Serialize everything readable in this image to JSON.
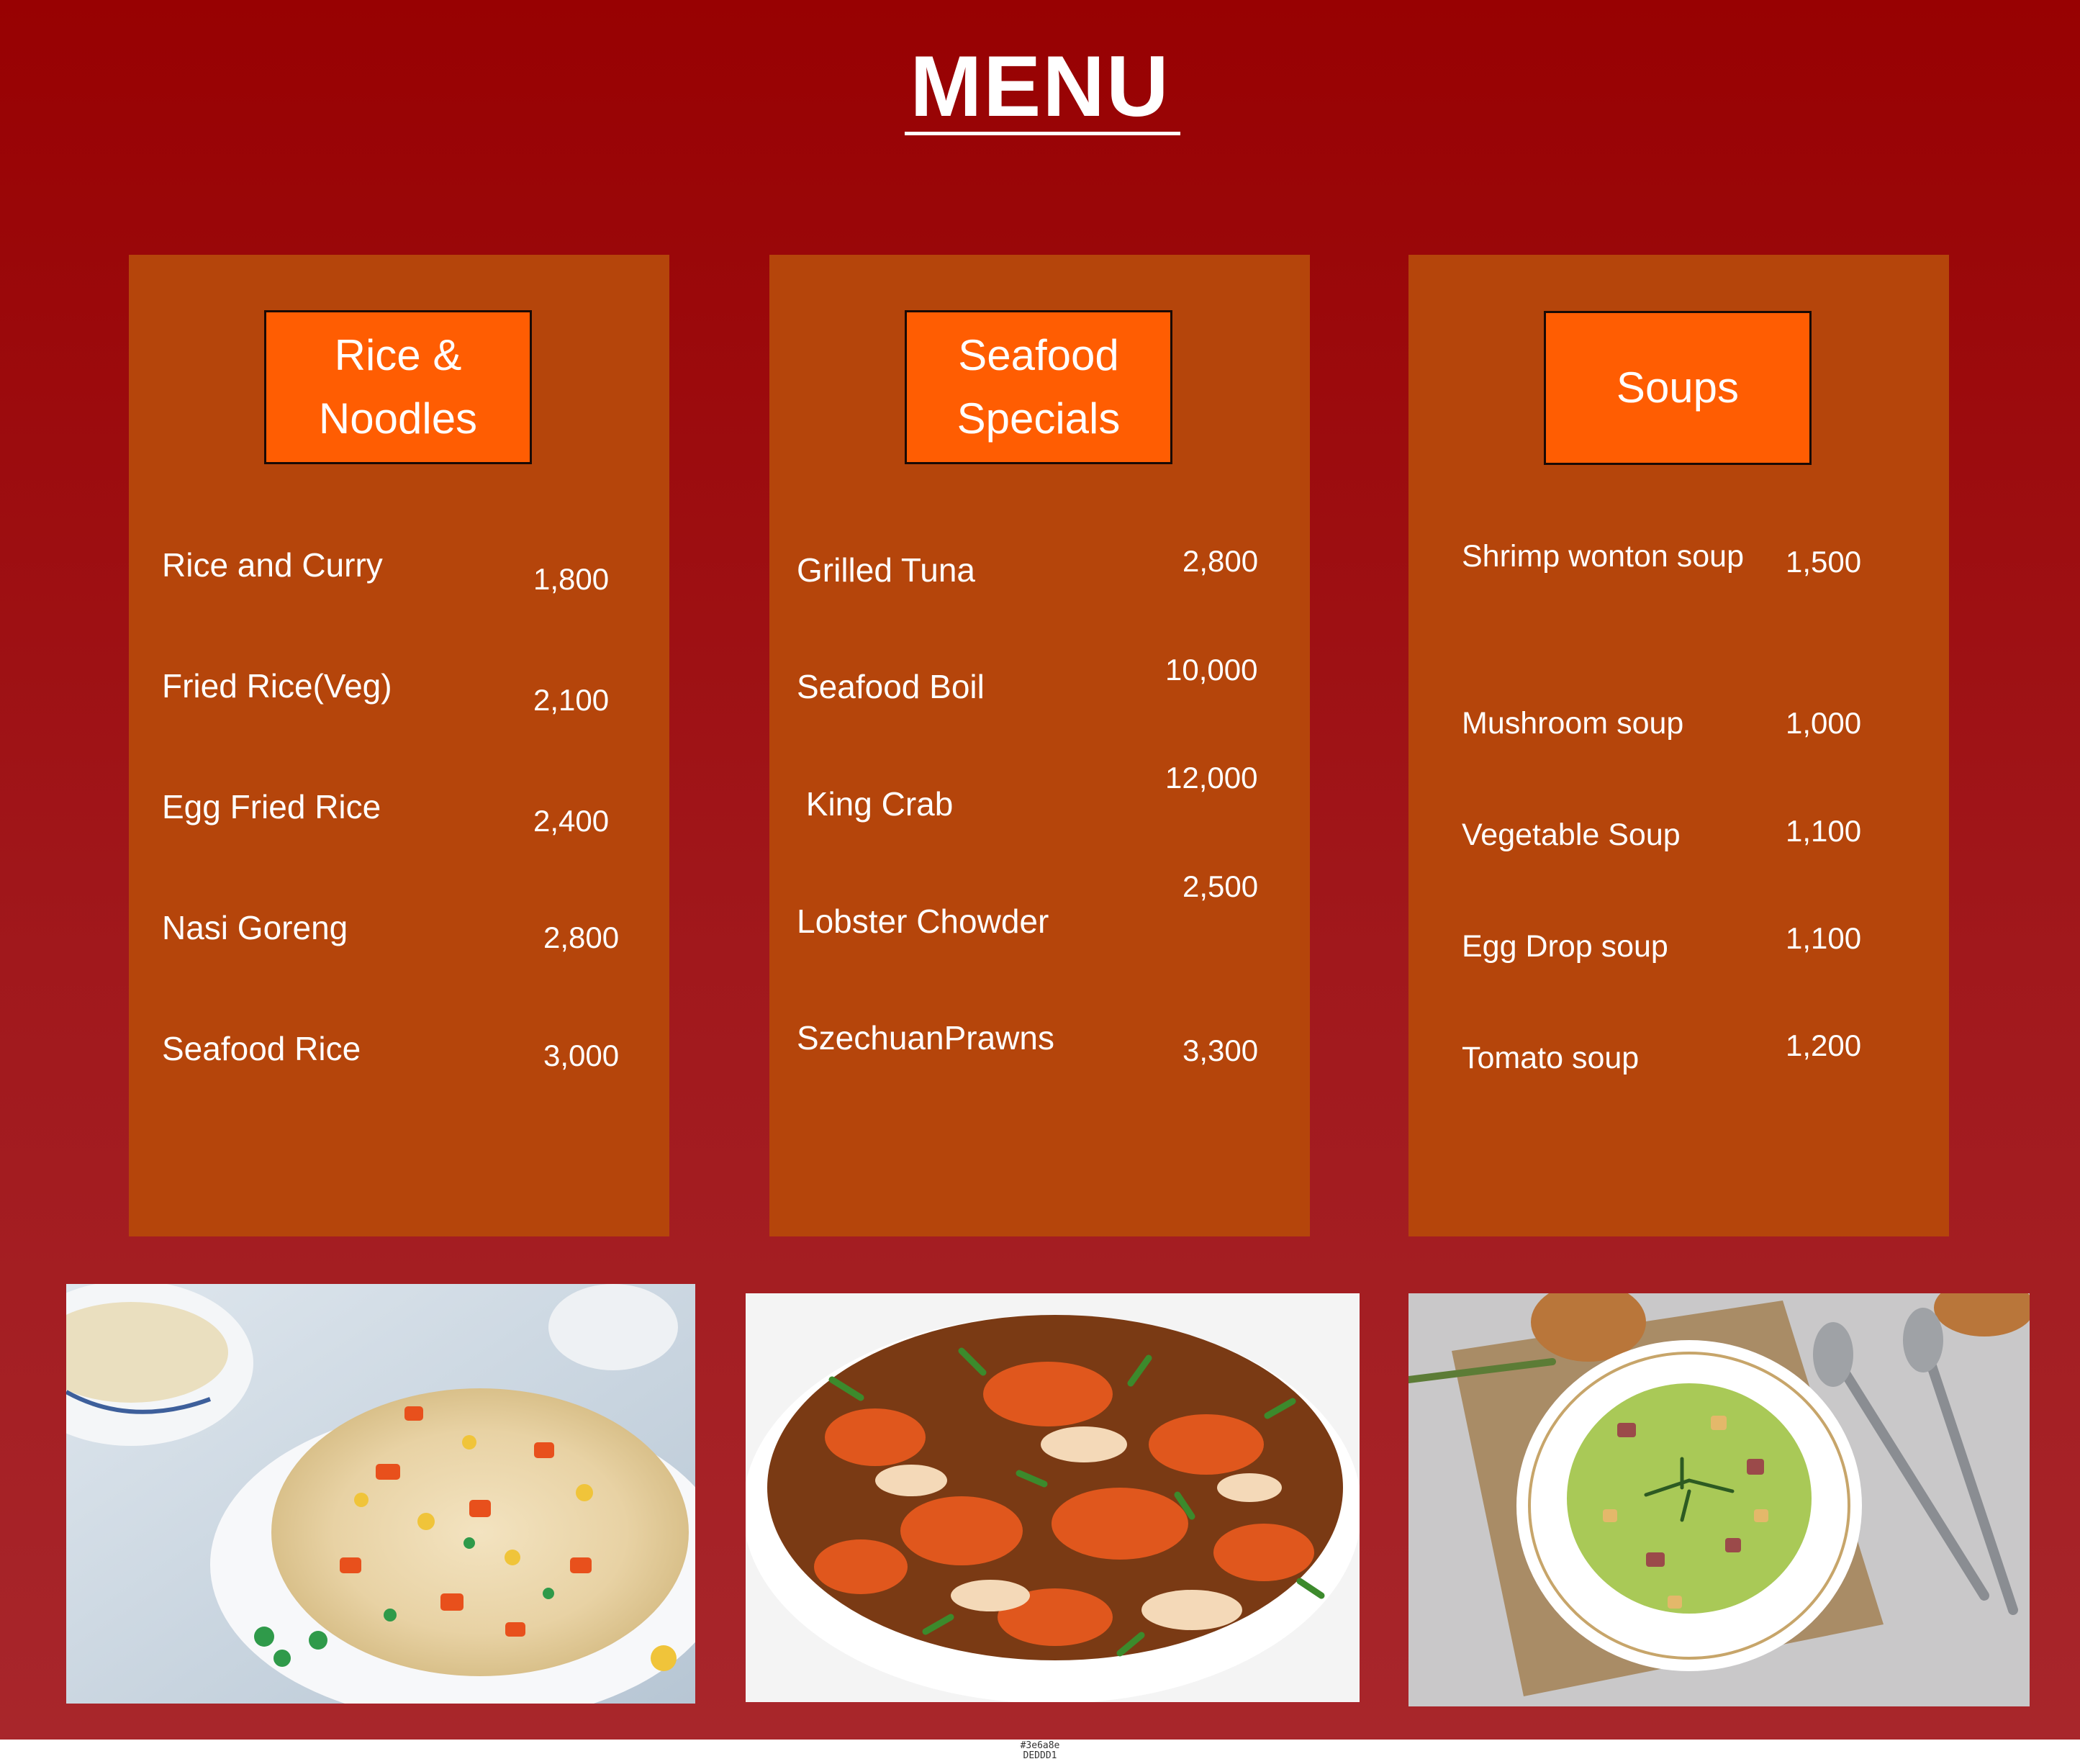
{
  "title": "MENU",
  "sections": [
    {
      "header": "Rice &\nNoodles",
      "items": [
        {
          "name": "Rice and Curry",
          "price": "1,800"
        },
        {
          "name": "Fried Rice(Veg)",
          "price": "2,100"
        },
        {
          "name": "Egg Fried Rice",
          "price": "2,400"
        },
        {
          "name": "Nasi Goreng",
          "price": "2,800"
        },
        {
          "name": "Seafood Rice",
          "price": "3,000"
        }
      ]
    },
    {
      "header": "Seafood\nSpecials",
      "items": [
        {
          "name": "Grilled Tuna",
          "price": "2,800"
        },
        {
          "name": "Seafood Boil",
          "price": "10,000"
        },
        {
          "name": " King Crab",
          "price": "12,000"
        },
        {
          "name": "Lobster Chowder",
          "price": "2,500"
        },
        {
          "name": "SzechuanPrawns",
          "price": "3,300"
        }
      ]
    },
    {
      "header": "Soups",
      "items": [
        {
          "name": "Shrimp wonton soup",
          "price": "1,500"
        },
        {
          "name": "Mushroom soup",
          "price": "1,000"
        },
        {
          "name": "Vegetable Soup",
          "price": "1,100"
        },
        {
          "name": "Egg Drop soup",
          "price": "1,100"
        },
        {
          "name": "Tomato soup",
          "price": "1,200"
        }
      ]
    }
  ],
  "photos": [
    {
      "icon": "fried-rice-photo"
    },
    {
      "icon": "crab-dish-photo"
    },
    {
      "icon": "soup-bowl-photo"
    }
  ],
  "footer": {
    "code_line1": "#3e6a8e",
    "code_line2": "DEDDD1"
  },
  "colors": {
    "background": "#9b0a0b",
    "panel": "#b5450b",
    "header_box": "#ff5d02",
    "text": "#ffffff"
  }
}
